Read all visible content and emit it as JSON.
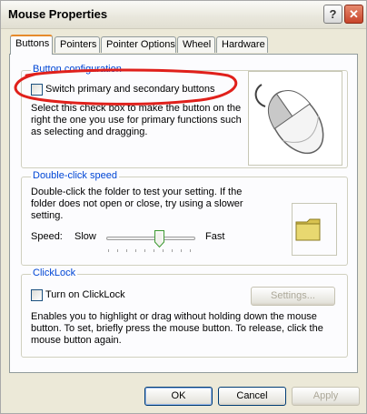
{
  "window": {
    "title": "Mouse Properties",
    "help_label": "?",
    "close_label": "✕"
  },
  "tabs": [
    {
      "label": "Buttons",
      "active": true
    },
    {
      "label": "Pointers",
      "active": false
    },
    {
      "label": "Pointer Options",
      "active": false
    },
    {
      "label": "Wheel",
      "active": false
    },
    {
      "label": "Hardware",
      "active": false
    }
  ],
  "button_config": {
    "group_label": "Button configuration",
    "switch_label": "Switch primary and secondary buttons",
    "switch_checked": false,
    "description": "Select this check box to make the button on the right the one you use for primary functions such as selecting and dragging."
  },
  "double_click": {
    "group_label": "Double-click speed",
    "description": "Double-click the folder to test your setting. If the folder does not open or close, try using a slower setting.",
    "speed_label": "Speed:",
    "slow_label": "Slow",
    "fast_label": "Fast",
    "speed_level": 0.6
  },
  "clicklock": {
    "group_label": "ClickLock",
    "turn_on_label": "Turn on ClickLock",
    "turn_on_checked": false,
    "settings_label": "Settings...",
    "description": "Enables you to highlight or drag without holding down the mouse button. To set, briefly press the mouse button. To release, click the mouse button again."
  },
  "footer": {
    "ok_label": "OK",
    "cancel_label": "Cancel",
    "apply_label": "Apply"
  },
  "colors": {
    "group_label": "#0046d5",
    "annotation": "#e0201b",
    "folder": "#e8d870"
  }
}
